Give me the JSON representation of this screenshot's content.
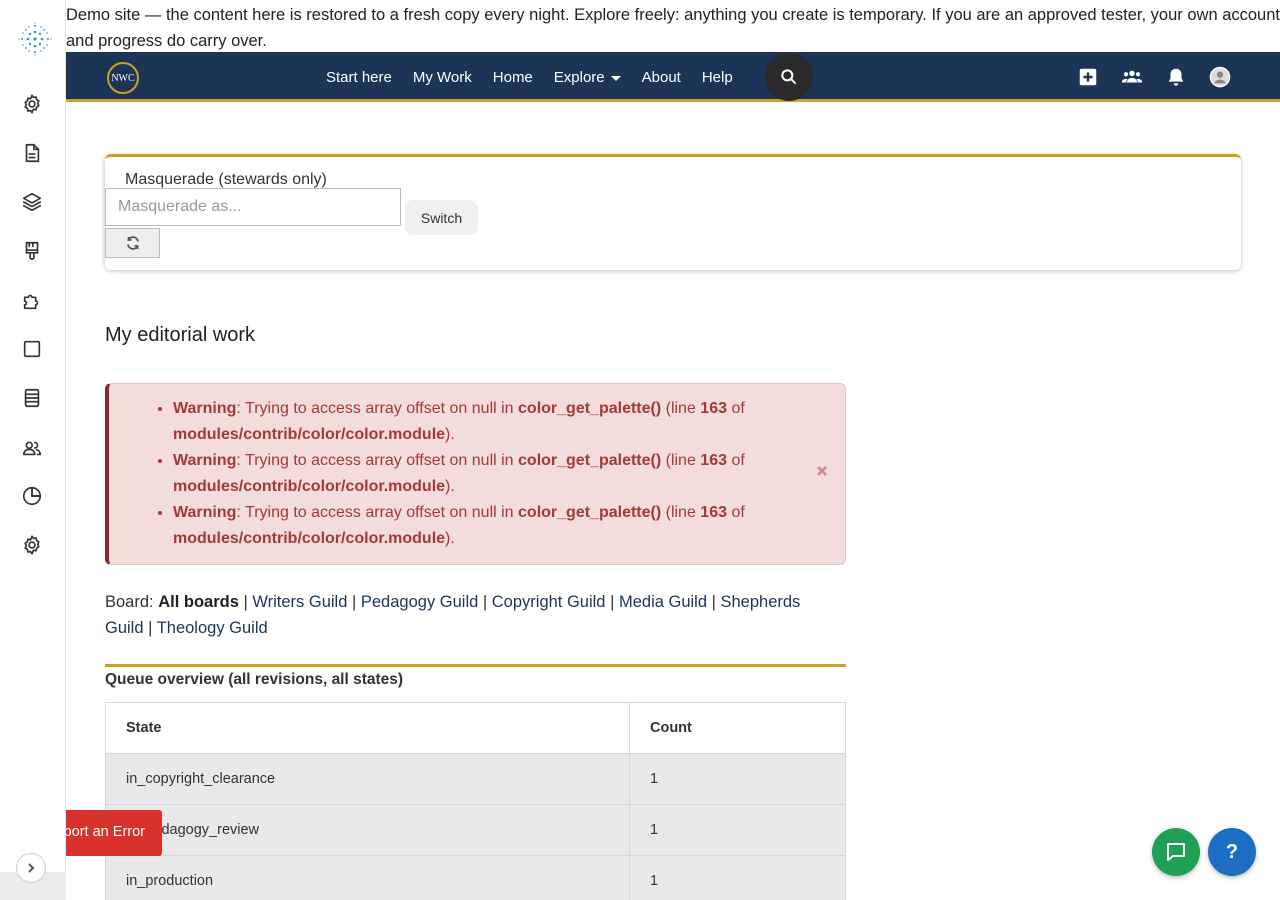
{
  "banner": {
    "text": "Demo site — the content here is restored to a fresh copy every night. Explore freely: anything you create is temporary. If you are an approved tester, your own account and progress do carry over."
  },
  "sidebar": {
    "items": [
      {
        "icon": "gear-icon"
      },
      {
        "icon": "file-icon"
      },
      {
        "icon": "layers-icon"
      },
      {
        "icon": "paint-brush-icon"
      },
      {
        "icon": "puzzle-icon"
      },
      {
        "icon": "square-icon"
      },
      {
        "icon": "book-icon"
      },
      {
        "icon": "people-icon"
      },
      {
        "icon": "pie-chart-icon"
      },
      {
        "icon": "settings-icon"
      }
    ]
  },
  "nav": {
    "logo_text": "NWC",
    "links": [
      "Start here",
      "My Work",
      "Home",
      "Explore",
      "About",
      "Help"
    ]
  },
  "masquerade": {
    "title": "Masquerade (stewards only)",
    "placeholder": "Masquerade as...",
    "switch_label": "Switch"
  },
  "editorial": {
    "title": "My editorial work"
  },
  "warnings": [
    {
      "label": "Warning",
      "text1": ": Trying to access array offset on null in ",
      "func": "color_get_palette()",
      "text2": " (line ",
      "line": "163",
      "text3": " of ",
      "file": "modules/contrib/color/color.module",
      "text4": ")."
    },
    {
      "label": "Warning",
      "text1": ": Trying to access array offset on null in ",
      "func": "color_get_palette()",
      "text2": " (line ",
      "line": "163",
      "text3": " of ",
      "file": "modules/contrib/color/color.module",
      "text4": ")."
    },
    {
      "label": "Warning",
      "text1": ": Trying to access array offset on null in ",
      "func": "color_get_palette()",
      "text2": " (line ",
      "line": "163",
      "text3": " of ",
      "file": "modules/contrib/color/color.module",
      "text4": ")."
    }
  ],
  "boards": {
    "label": "Board: ",
    "separator": " | ",
    "items": [
      "All boards",
      "Writers Guild",
      "Pedagogy Guild",
      "Copyright Guild",
      "Media Guild",
      "Shepherds Guild",
      "Theology Guild"
    ]
  },
  "queue": {
    "title": "Queue overview (all revisions, all states)",
    "headers": [
      "State",
      "Count"
    ],
    "rows": [
      [
        "in_copyright_clearance",
        "1"
      ],
      [
        "in_pedagogy_review",
        "1"
      ],
      [
        "in_production",
        "1"
      ]
    ]
  },
  "report_error": {
    "label": "Report an Error"
  },
  "help": {
    "label": "?"
  },
  "colors": {
    "nav_bg": "#1c3557",
    "accent_gold": "#c9a227",
    "warning_bg": "#f2dcdc",
    "warning_text": "#a33a36",
    "report_red": "#d9312b",
    "chat_green": "#1fa055",
    "help_blue": "#1b6ec2"
  }
}
